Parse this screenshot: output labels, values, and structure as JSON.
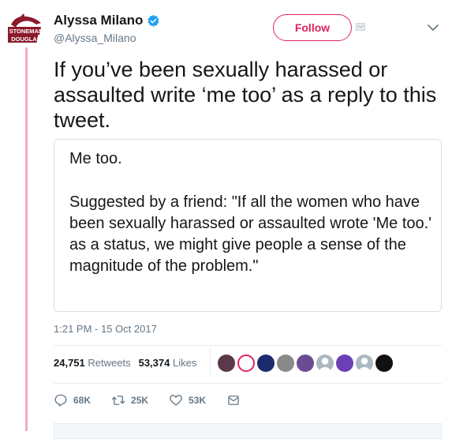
{
  "author": {
    "display_name": "Alyssa Milano",
    "handle": "@Alyssa_Milano",
    "avatar_logo_text": [
      "STONEMAN",
      "DOUGLAS"
    ],
    "verified": true
  },
  "follow_button": {
    "label": "Follow"
  },
  "tweet": {
    "text": "If you’ve been sexually harassed or\nassaulted write ‘me too’ as a reply to this\ntweet.",
    "quote": {
      "line1": "Me too.",
      "line2": "Suggested by a friend: \"If all the women who have been sexually harassed or assaulted wrote 'Me too.' as a status, we might give people a sense of the magnitude of the problem.\""
    },
    "timestamp": "1:21 PM - 15 Oct 2017"
  },
  "stats": {
    "retweets_count": "24,751",
    "retweets_label": "Retweets",
    "likes_count": "53,374",
    "likes_label": "Likes"
  },
  "likers": [
    {
      "name": "liker-avatar-1",
      "color": "#5a3a4a"
    },
    {
      "name": "liker-avatar-2",
      "color": "#ffffff"
    },
    {
      "name": "liker-avatar-3",
      "color": "#1c2a6e"
    },
    {
      "name": "liker-avatar-4",
      "color": "#8a8a8a"
    },
    {
      "name": "liker-avatar-5",
      "color": "#6a4c93"
    },
    {
      "name": "liker-avatar-6",
      "color": "#aab8c2"
    },
    {
      "name": "liker-avatar-7",
      "color": "#6c3fb5"
    },
    {
      "name": "liker-avatar-8",
      "color": "#aab8c2"
    },
    {
      "name": "liker-avatar-9",
      "color": "#111111"
    }
  ],
  "actions": {
    "reply_count": "68K",
    "retweet_count": "25K",
    "like_count": "53K"
  },
  "colors": {
    "accent": "#e0245e",
    "thread_line": "#f5a9c0",
    "verified": "#1da1f2",
    "muted": "#657786"
  }
}
